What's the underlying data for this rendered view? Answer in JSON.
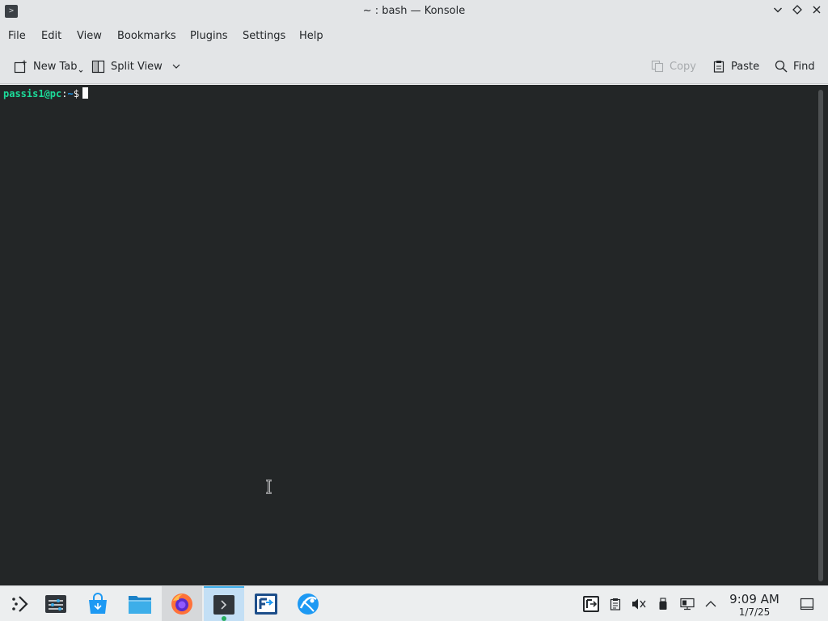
{
  "window": {
    "title": "~ : bash — Konsole",
    "app_icon_glyph": ">",
    "controls": [
      "chevron-down-icon",
      "diamond-icon",
      "close-icon"
    ]
  },
  "menu": {
    "items": [
      "File",
      "Edit",
      "View",
      "Bookmarks",
      "Plugins",
      "Settings",
      "Help"
    ]
  },
  "toolbar": {
    "new_tab": "New Tab",
    "split_view": "Split View",
    "copy": "Copy",
    "paste": "Paste",
    "find": "Find"
  },
  "terminal": {
    "user_host": "passis1@pc",
    "path_sep": ":",
    "path": "~",
    "prompt_symbol": "$",
    "background": "#232627",
    "prompt_color": "#1cdc9a",
    "path_color": "#1d99f3"
  },
  "taskbar": {
    "tasks": [
      "app-launcher-icon",
      "settings-icon",
      "discover-store-icon",
      "file-manager-icon",
      "firefox-icon",
      "konsole-icon",
      "remote-desktop-icon",
      "browser-globe-icon"
    ],
    "tray": [
      "remote-desktop-tray-icon",
      "clipboard-icon",
      "volume-muted-icon",
      "usb-device-icon",
      "network-icon",
      "show-more-icon"
    ],
    "clock": {
      "time": "9:09 AM",
      "date": "1/7/25"
    },
    "accent": "#3daee9"
  }
}
